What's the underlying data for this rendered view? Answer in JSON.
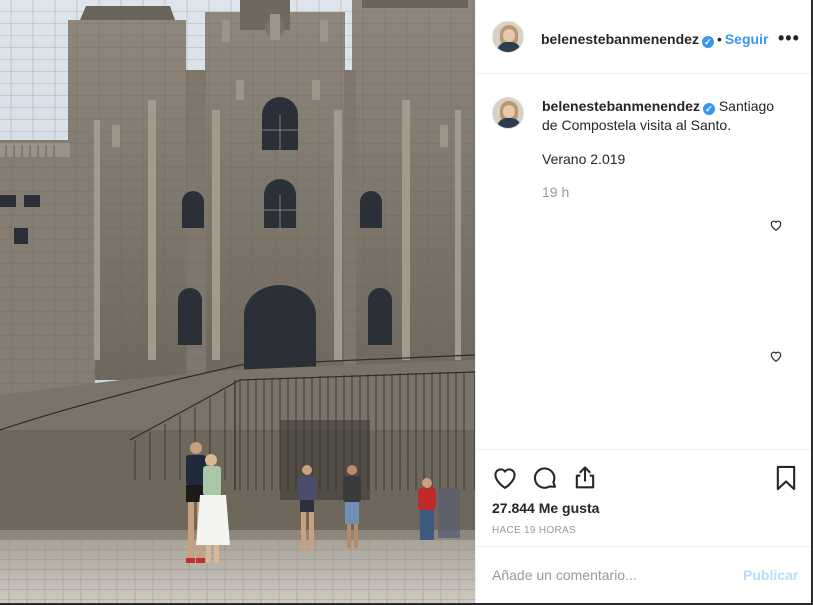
{
  "post": {
    "username": "belenestebanmenendez",
    "follow_label": "Seguir",
    "more_label": "•••",
    "separator": "•",
    "verified_mark": "✓",
    "caption_text": "Santiago de Compostela visita al Santo.",
    "caption_line2": "Verano 2.019",
    "time_ago": "19 h",
    "likes": "27.844 Me gusta",
    "posted_ago": "HACE 19 HORAS",
    "comment_placeholder": "Añade un comentario...",
    "publish_label": "Publicar"
  },
  "photo": {
    "subject": "Catedral de Santiago de Compostela, Praza do Obradoiro"
  },
  "icons": {
    "like": "heart-icon",
    "comment": "comment-icon",
    "share": "share-icon",
    "save": "bookmark-icon",
    "more": "more-options-icon"
  },
  "colors": {
    "accent": "#3897f0",
    "publish_disabled": "#b2dffc",
    "muted_text": "#999999",
    "text": "#262626"
  }
}
